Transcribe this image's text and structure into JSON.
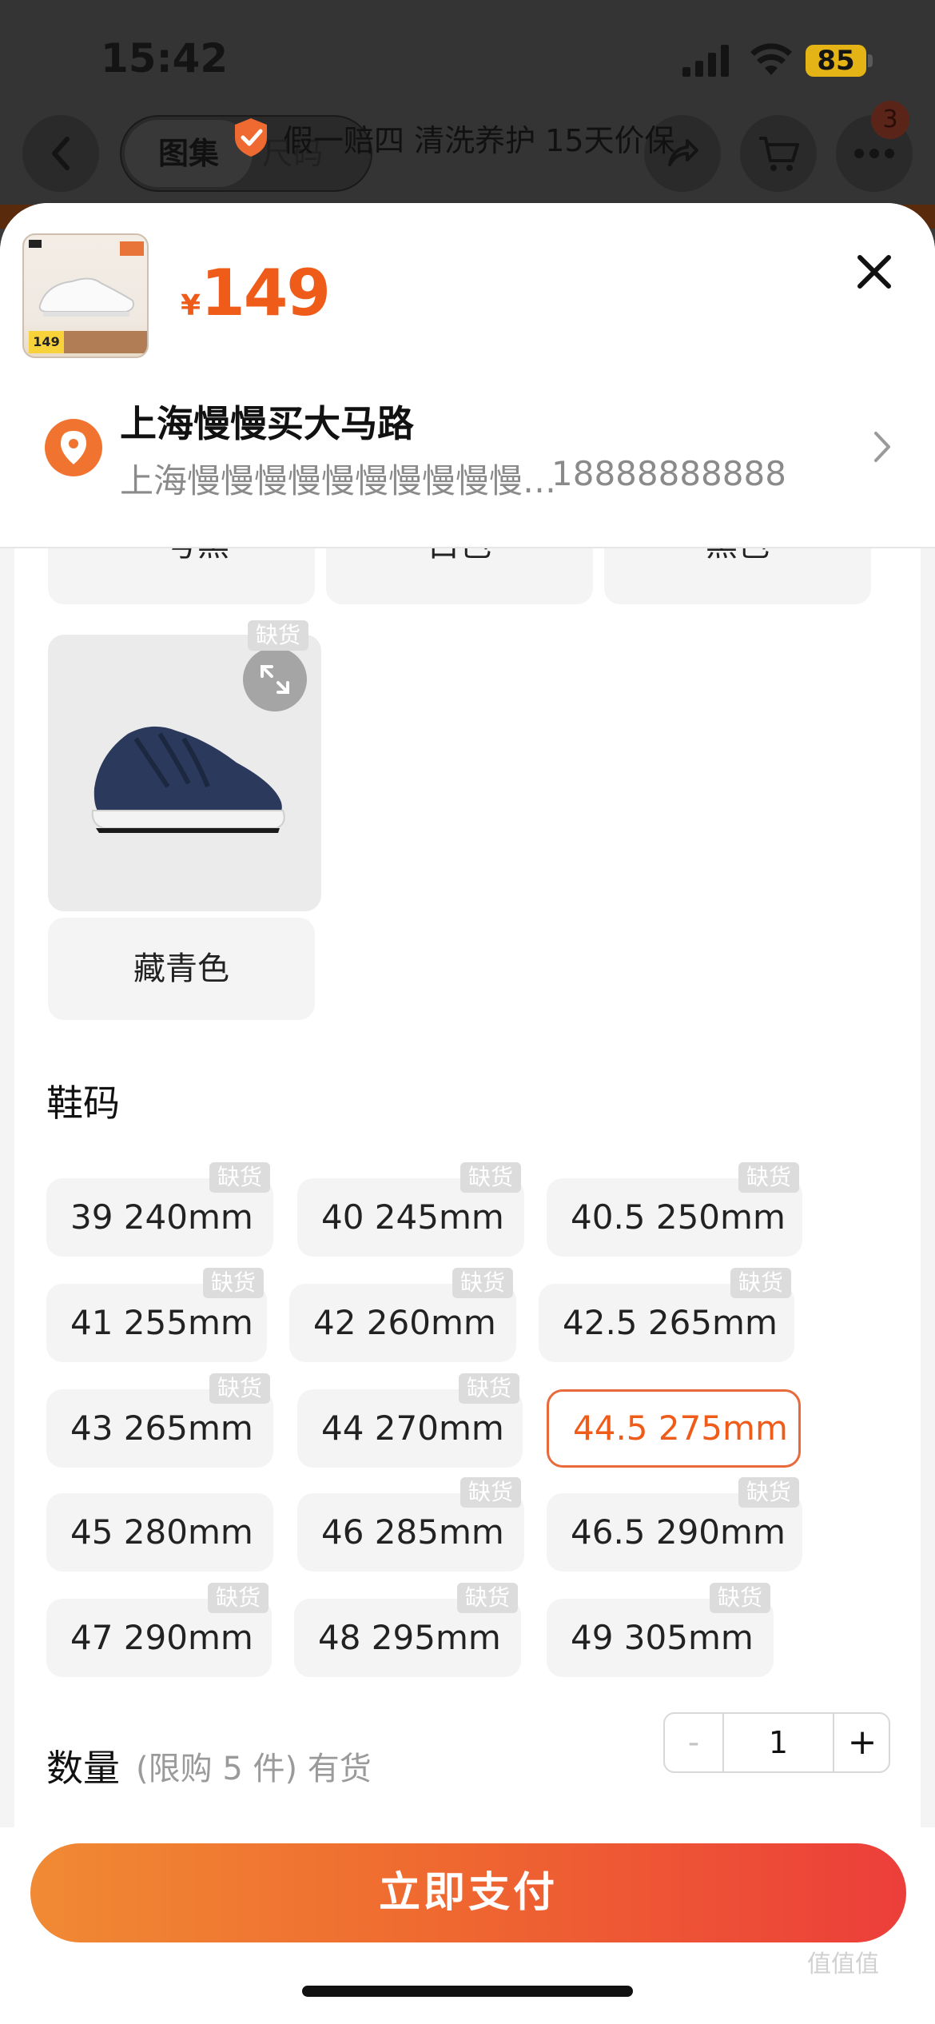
{
  "status_bar": {
    "time": "15:42",
    "battery": "85"
  },
  "nav": {
    "tab_active": "图集",
    "tab_inactive": "尺码",
    "promo_text": "假一赔四 清洗养护 15天价保",
    "cart_badge": "3"
  },
  "product": {
    "thumb_price": "149",
    "currency": "¥",
    "price": "149"
  },
  "address": {
    "name": "上海慢慢买大马路",
    "detail": "上海慢慢慢慢慢慢慢慢慢慢…",
    "phone": "18888888888"
  },
  "colors": {
    "top_row": [
      "一号黑",
      "白色",
      "黑色"
    ],
    "card_label": "藏青色",
    "out_of_stock": "缺货"
  },
  "sizes": {
    "title": "鞋码",
    "oos_label": "缺货",
    "items": [
      {
        "label": "39 240mm"
      },
      {
        "label": "40 245mm"
      },
      {
        "label": "40.5 250mm"
      },
      {
        "label": "41 255mm"
      },
      {
        "label": "42 260mm"
      },
      {
        "label": "42.5 265mm"
      },
      {
        "label": "43 265mm"
      },
      {
        "label": "44 270mm"
      },
      {
        "label": "44.5 275mm"
      },
      {
        "label": "45 280mm"
      },
      {
        "label": "46 285mm"
      },
      {
        "label": "46.5 290mm"
      },
      {
        "label": "47 290mm"
      },
      {
        "label": "48 295mm"
      },
      {
        "label": "49 305mm"
      }
    ]
  },
  "quantity": {
    "label": "数量",
    "note": "(限购 5 件) 有货",
    "minus": "-",
    "value": "1",
    "plus": "+"
  },
  "pay_button": "立即支付",
  "watermark": "值值值"
}
